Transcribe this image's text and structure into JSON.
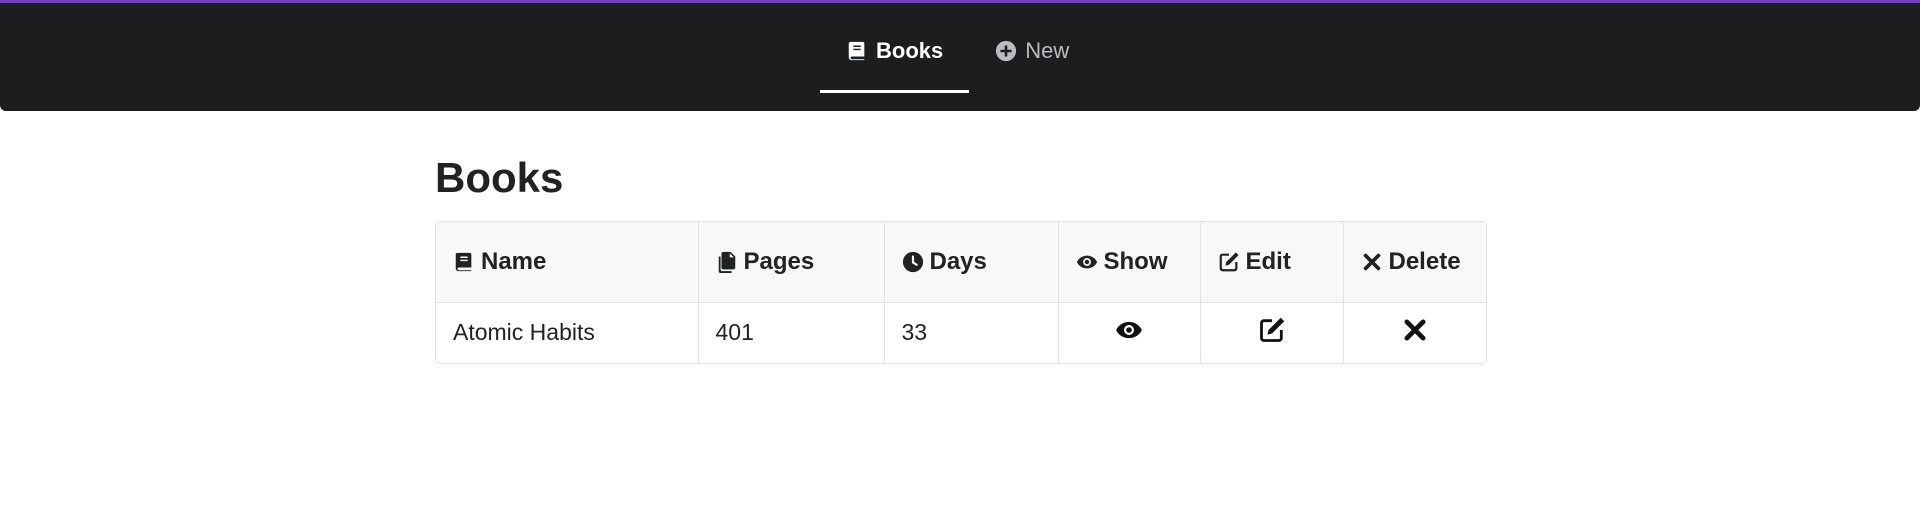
{
  "nav": {
    "items": [
      {
        "label": "Books",
        "icon": "book-icon",
        "active": true
      },
      {
        "label": "New",
        "icon": "plus-circle-icon",
        "active": false
      }
    ]
  },
  "page": {
    "title": "Books"
  },
  "table": {
    "columns": [
      {
        "label": "Name",
        "icon": "book-icon"
      },
      {
        "label": "Pages",
        "icon": "copy-icon"
      },
      {
        "label": "Days",
        "icon": "clock-icon"
      },
      {
        "label": "Show",
        "icon": "eye-icon"
      },
      {
        "label": "Edit",
        "icon": "edit-icon"
      },
      {
        "label": "Delete",
        "icon": "times-icon"
      }
    ],
    "rows": [
      {
        "name": "Atomic Habits",
        "pages": "401",
        "days": "33"
      }
    ]
  },
  "colors": {
    "navbar_bg": "#1c1d1f",
    "navbar_accent": "#6f42c1",
    "table_header_bg": "#f7f8fa"
  }
}
